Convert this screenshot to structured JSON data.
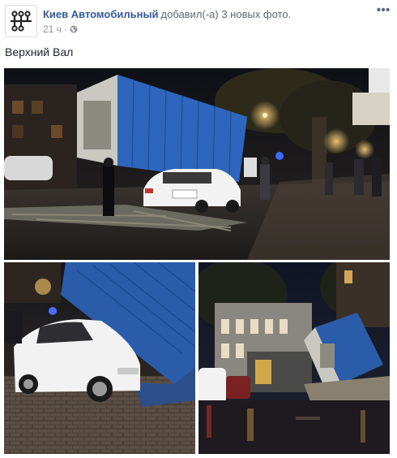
{
  "post": {
    "author": "Киев Автомобильный",
    "action": "добавил(-а) 3 новых фото.",
    "time": "21 ч",
    "separator": "·",
    "text": "Верхний Вал",
    "more_glyph": "•••",
    "icons": {
      "avatar": "steering-logo-icon",
      "privacy": "globe-icon",
      "more": "more-options-icon"
    }
  },
  "colors": {
    "link": "#365899",
    "muted": "#90949c",
    "text": "#1d2129",
    "kiosk_blue": "#2a5caa",
    "car_white": "#f2f2f2",
    "night_sky": "#14161c"
  },
  "photos": [
    {
      "scene": "main-night-street-kiosk-on-car"
    },
    {
      "scene": "closeup-kiosk-on-white-car"
    },
    {
      "scene": "wide-street-overturned-kiosk"
    }
  ]
}
